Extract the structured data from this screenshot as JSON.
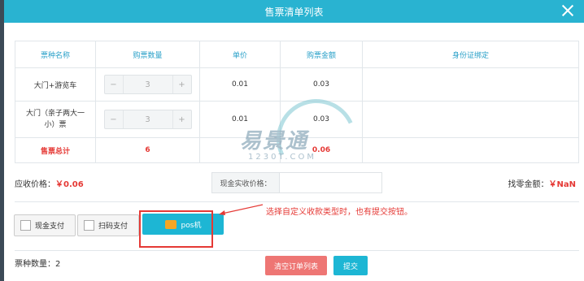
{
  "dialog": {
    "title": "售票清单列表"
  },
  "table": {
    "headers": [
      "票种名称",
      "购票数量",
      "单价",
      "购票金额",
      "身份证绑定"
    ],
    "rows": [
      {
        "name": "大门+游览车",
        "qty": "3",
        "price": "0.01",
        "amount": "0.03",
        "minus": "−",
        "plus": "+"
      },
      {
        "name": "大门（亲子两大一小）票",
        "qty": "3",
        "price": "0.01",
        "amount": "0.03",
        "minus": "−",
        "plus": "+"
      }
    ],
    "total": {
      "label": "售票总计",
      "qty": "6",
      "amount": "0.06"
    }
  },
  "watermark": {
    "brand": "易景通",
    "url": "1230T.COM"
  },
  "summary": {
    "receivable_label": "应收价格：",
    "receivable_value": "￥0.06",
    "cash_label": "现金实收价格：",
    "cash_value": "",
    "change_label": "找零金额：",
    "change_value": "￥NaN"
  },
  "payments": [
    {
      "label": "现金支付"
    },
    {
      "label": "扫码支付"
    },
    {
      "label": "pos机"
    }
  ],
  "annotation": "选择自定义收款类型时，也有提交按钮。",
  "footer": {
    "ticket_count_label": "票种数量：2",
    "clear_label": "清空订单列表",
    "submit_label": "提交"
  },
  "colors": {
    "accent": "#29b3d1",
    "danger": "#e53935",
    "clear_button": "#ee7674",
    "submit_button": "#1db6d4"
  }
}
